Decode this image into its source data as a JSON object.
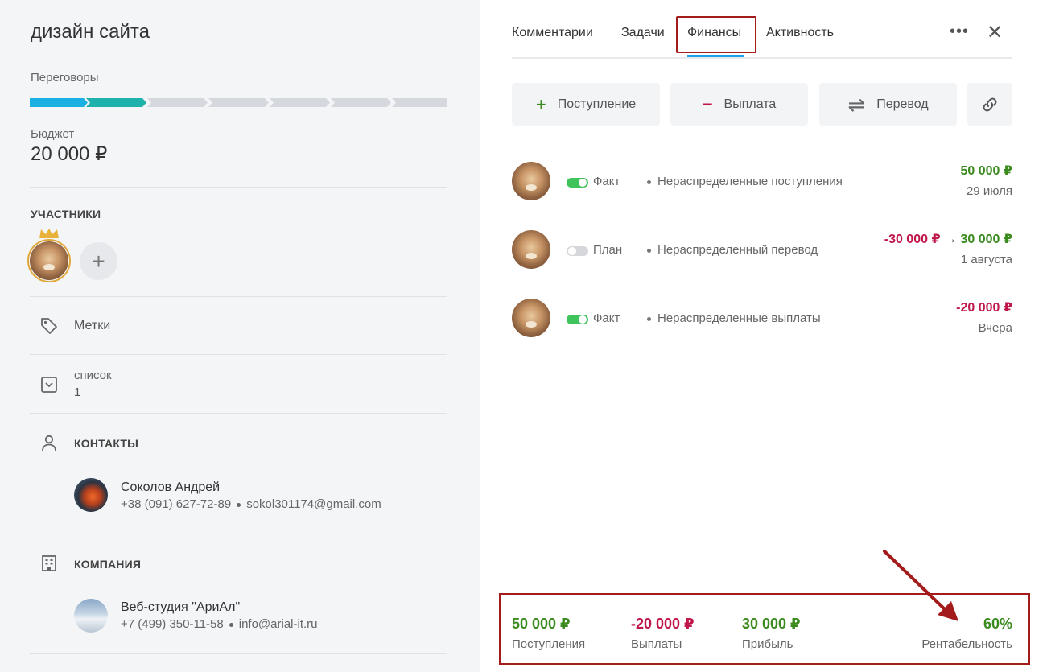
{
  "deal": {
    "title": "дизайн сайта",
    "stage_label": "Переговоры",
    "pipeline": {
      "total_stages": 7,
      "completed_stages": 2,
      "colors": {
        "done_1": "#1ab0e2",
        "done_2": "#1fb2ad",
        "todo": "#d5d9de"
      }
    },
    "budget_label": "Бюджет",
    "budget_value": "20 000 ₽"
  },
  "participants": {
    "heading": "УЧАСТНИКИ",
    "add_icon": "+"
  },
  "tags": {
    "label": "Метки",
    "icon": "tag-icon"
  },
  "list_field": {
    "label": "список",
    "value": "1",
    "icon": "chevron-down-box-icon"
  },
  "contacts": {
    "heading": "КОНТАКТЫ",
    "icon": "person-icon",
    "person": {
      "name": "Соколов Андрей",
      "phone": "+38 (091) 627-72-89",
      "email": "sokol301174@gmail.com"
    }
  },
  "company": {
    "heading": "КОМПАНИЯ",
    "icon": "building-icon",
    "org": {
      "name": "Веб-студия \"АриАл\"",
      "phone": "+7 (499) 350-11-58",
      "email": "info@arial-it.ru"
    }
  },
  "tabs": {
    "items": [
      {
        "label": "Комментарии"
      },
      {
        "label": "Задачи"
      },
      {
        "label": "Финансы",
        "active": true
      },
      {
        "label": "Активность"
      }
    ],
    "more_icon": "•••",
    "close_icon": "✕"
  },
  "actions": {
    "income": {
      "label": "Поступление",
      "icon": "+"
    },
    "payout": {
      "label": "Выплата",
      "icon": "−"
    },
    "transfer": {
      "label": "Перевод",
      "icon": "⇌"
    },
    "link": {
      "icon": "link-icon"
    }
  },
  "transactions": [
    {
      "status": "Факт",
      "enabled": true,
      "category": "Нераспределенные поступления",
      "amount": "50 000 ₽",
      "amount_color": "#3a8a1e",
      "date": "29 июля"
    },
    {
      "status": "План",
      "enabled": false,
      "category": "Нераспределенный перевод",
      "amount_from": "-30 000 ₽",
      "arrow": "→",
      "amount_to": "30 000 ₽",
      "date": "1 августа"
    },
    {
      "status": "Факт",
      "enabled": true,
      "category": "Нераспределенные выплаты",
      "amount": "-20 000 ₽",
      "amount_color": "#c0174b",
      "date": "Вчера"
    }
  ],
  "summary": {
    "income": {
      "value": "50 000 ₽",
      "label": "Поступления"
    },
    "payouts": {
      "value": "-20 000 ₽",
      "label": "Выплаты"
    },
    "profit": {
      "value": "30 000 ₽",
      "label": "Прибыль"
    },
    "profitability": {
      "value": "60%",
      "label": "Рентабельность"
    }
  },
  "colors": {
    "accent_blue": "#1da1e8",
    "positive": "#3a8a1e",
    "negative": "#c0174b",
    "highlight": "#a31b1b"
  }
}
